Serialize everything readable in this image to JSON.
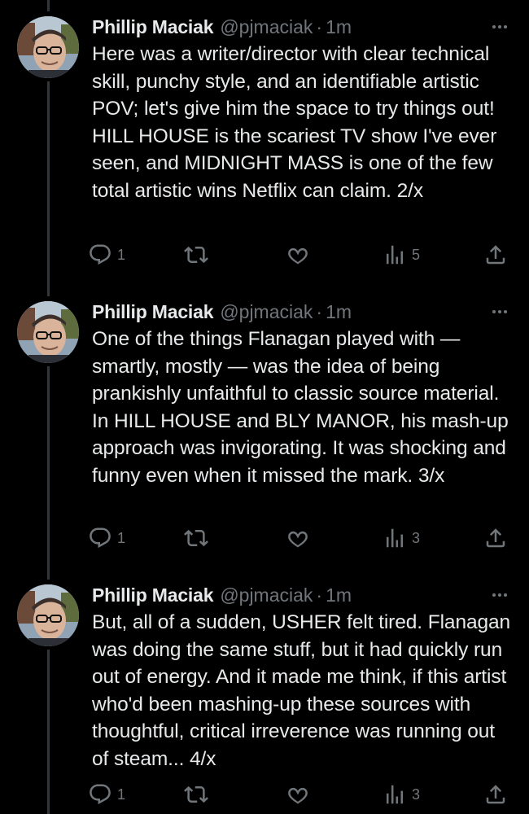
{
  "colors": {
    "background": "#000000",
    "text": "#e7e9ea",
    "secondary": "#71767b",
    "thread_line": "#333639"
  },
  "tweets": [
    {
      "name": "Phillip Maciak",
      "handle": "@pjmaciak",
      "dot": "·",
      "time": "1m",
      "text": "Here was a writer/director with clear technical skill, punchy style, and an identifiable artistic POV; let's give him the space to try things out! HILL HOUSE is the scariest TV show I've ever seen, and MIDNIGHT MASS is one of the few total artistic wins Netflix can claim. 2/x",
      "replies": "1",
      "views": "5"
    },
    {
      "name": "Phillip Maciak",
      "handle": "@pjmaciak",
      "dot": "·",
      "time": "1m",
      "text": "One of the things Flanagan played with — smartly, mostly — was the idea of being prankishly unfaithful to classic source material. In HILL HOUSE and BLY MANOR, his mash-up approach was invigorating. It was shocking and funny even when it missed the mark. 3/x",
      "replies": "1",
      "views": "3"
    },
    {
      "name": "Phillip Maciak",
      "handle": "@pjmaciak",
      "dot": "·",
      "time": "1m",
      "text": "But, all of a sudden, USHER felt tired. Flanagan was doing the same stuff, but it had quickly run out of energy. And it made me think, if this artist who'd been mashing-up these sources with thoughtful, critical irreverence was running out of steam... 4/x",
      "replies": "1",
      "views": "3"
    }
  ],
  "icons": {
    "more": "more-icon",
    "reply": "reply-icon",
    "retweet": "retweet-icon",
    "like": "like-icon",
    "views": "views-icon",
    "share": "share-icon"
  }
}
